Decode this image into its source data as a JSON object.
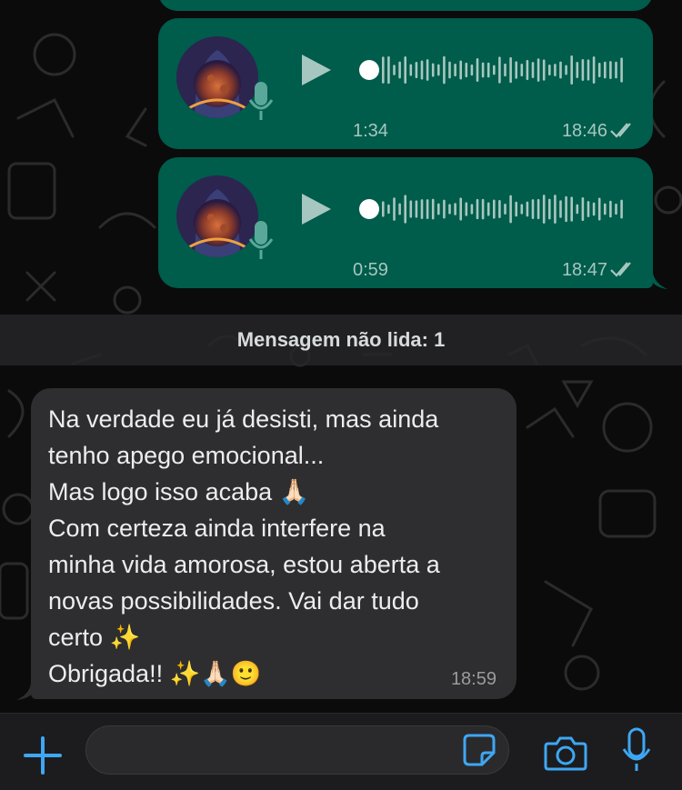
{
  "colors": {
    "outgoing_bubble": "#005c4b",
    "incoming_bubble": "#2e2e30",
    "accent": "#3ea7f3",
    "background": "#0b0b0b"
  },
  "voice_messages": [
    {
      "duration": "1:34",
      "time": "18:46",
      "status_icon": "double-check-icon"
    },
    {
      "duration": "0:59",
      "time": "18:47",
      "status_icon": "double-check-icon"
    }
  ],
  "unread_banner": "Mensagem não lida: 1",
  "incoming_message": {
    "text": "Na verdade eu já desisti, mas ainda\ntenho apego emocional...\nMas logo isso acaba 🙏🏻\nCom certeza ainda interfere na\nminha vida amorosa, estou aberta a\nnovas possibilidades. Vai dar tudo\ncerto ✨\nObrigada!! ✨🙏🏻🙂",
    "time": "18:59"
  },
  "composer": {
    "icons": [
      "plus-icon",
      "sticker-icon",
      "camera-icon",
      "microphone-icon"
    ]
  }
}
